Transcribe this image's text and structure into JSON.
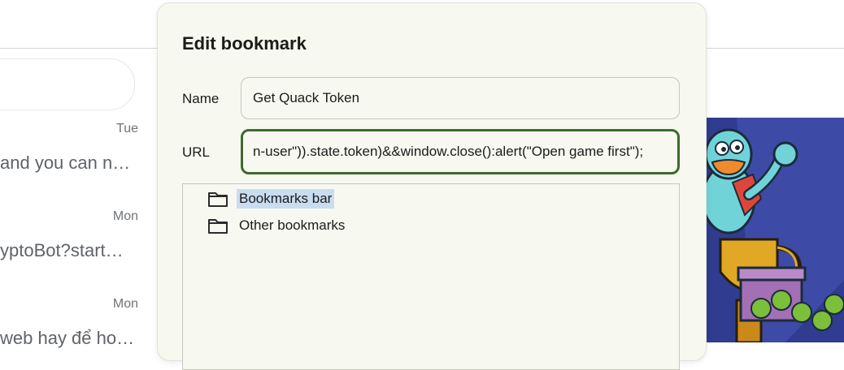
{
  "background": {
    "chats": [
      {
        "time": "Tue",
        "snippet": "and you can n…"
      },
      {
        "time": "Mon",
        "snippet": "yptoBot?start…"
      },
      {
        "time": "Mon",
        "snippet": "web hay để ho…"
      }
    ]
  },
  "dialog": {
    "title": "Edit bookmark",
    "name_label": "Name",
    "name_value": "Get Quack Token",
    "url_label": "URL",
    "url_value": "n-user\")).state.token)&&window.close():alert(\"Open game first\");",
    "folders": [
      {
        "label": "Bookmarks bar",
        "selected": true,
        "icon": "folder-icon"
      },
      {
        "label": "Other bookmarks",
        "selected": false,
        "icon": "folder-icon"
      }
    ]
  },
  "colors": {
    "focus_border": "#3e6a2c",
    "selection": "#c8ddf0",
    "dialog_bg": "#f7f8f0"
  }
}
